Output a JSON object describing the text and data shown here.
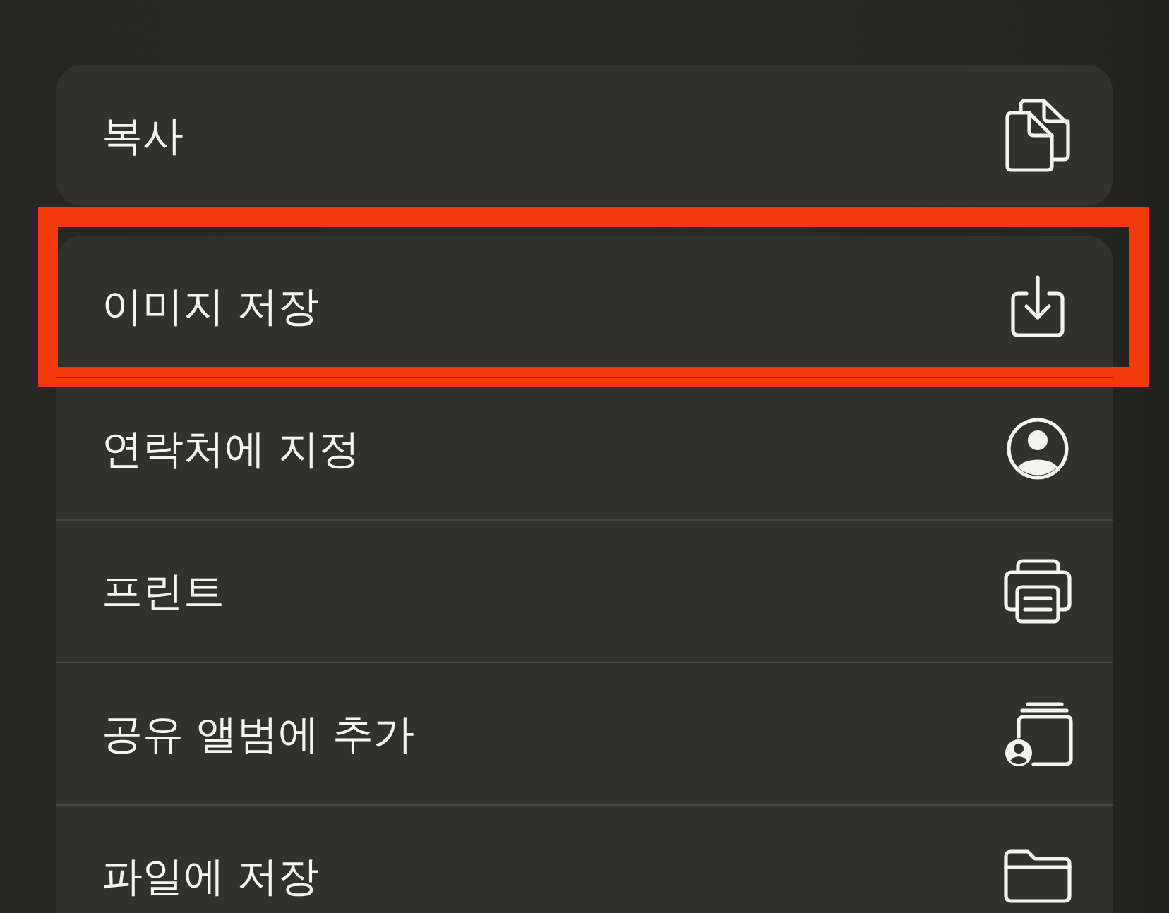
{
  "groups": [
    {
      "items": [
        {
          "label": "복사",
          "highlighted": false
        }
      ]
    },
    {
      "items": [
        {
          "label": "이미지 저장",
          "highlighted": true
        },
        {
          "label": "연락처에 지정",
          "highlighted": false
        },
        {
          "label": "프린트",
          "highlighted": false
        },
        {
          "label": "공유 앨범에 추가",
          "highlighted": false
        },
        {
          "label": "파일에 저장",
          "highlighted": false
        }
      ]
    }
  ]
}
